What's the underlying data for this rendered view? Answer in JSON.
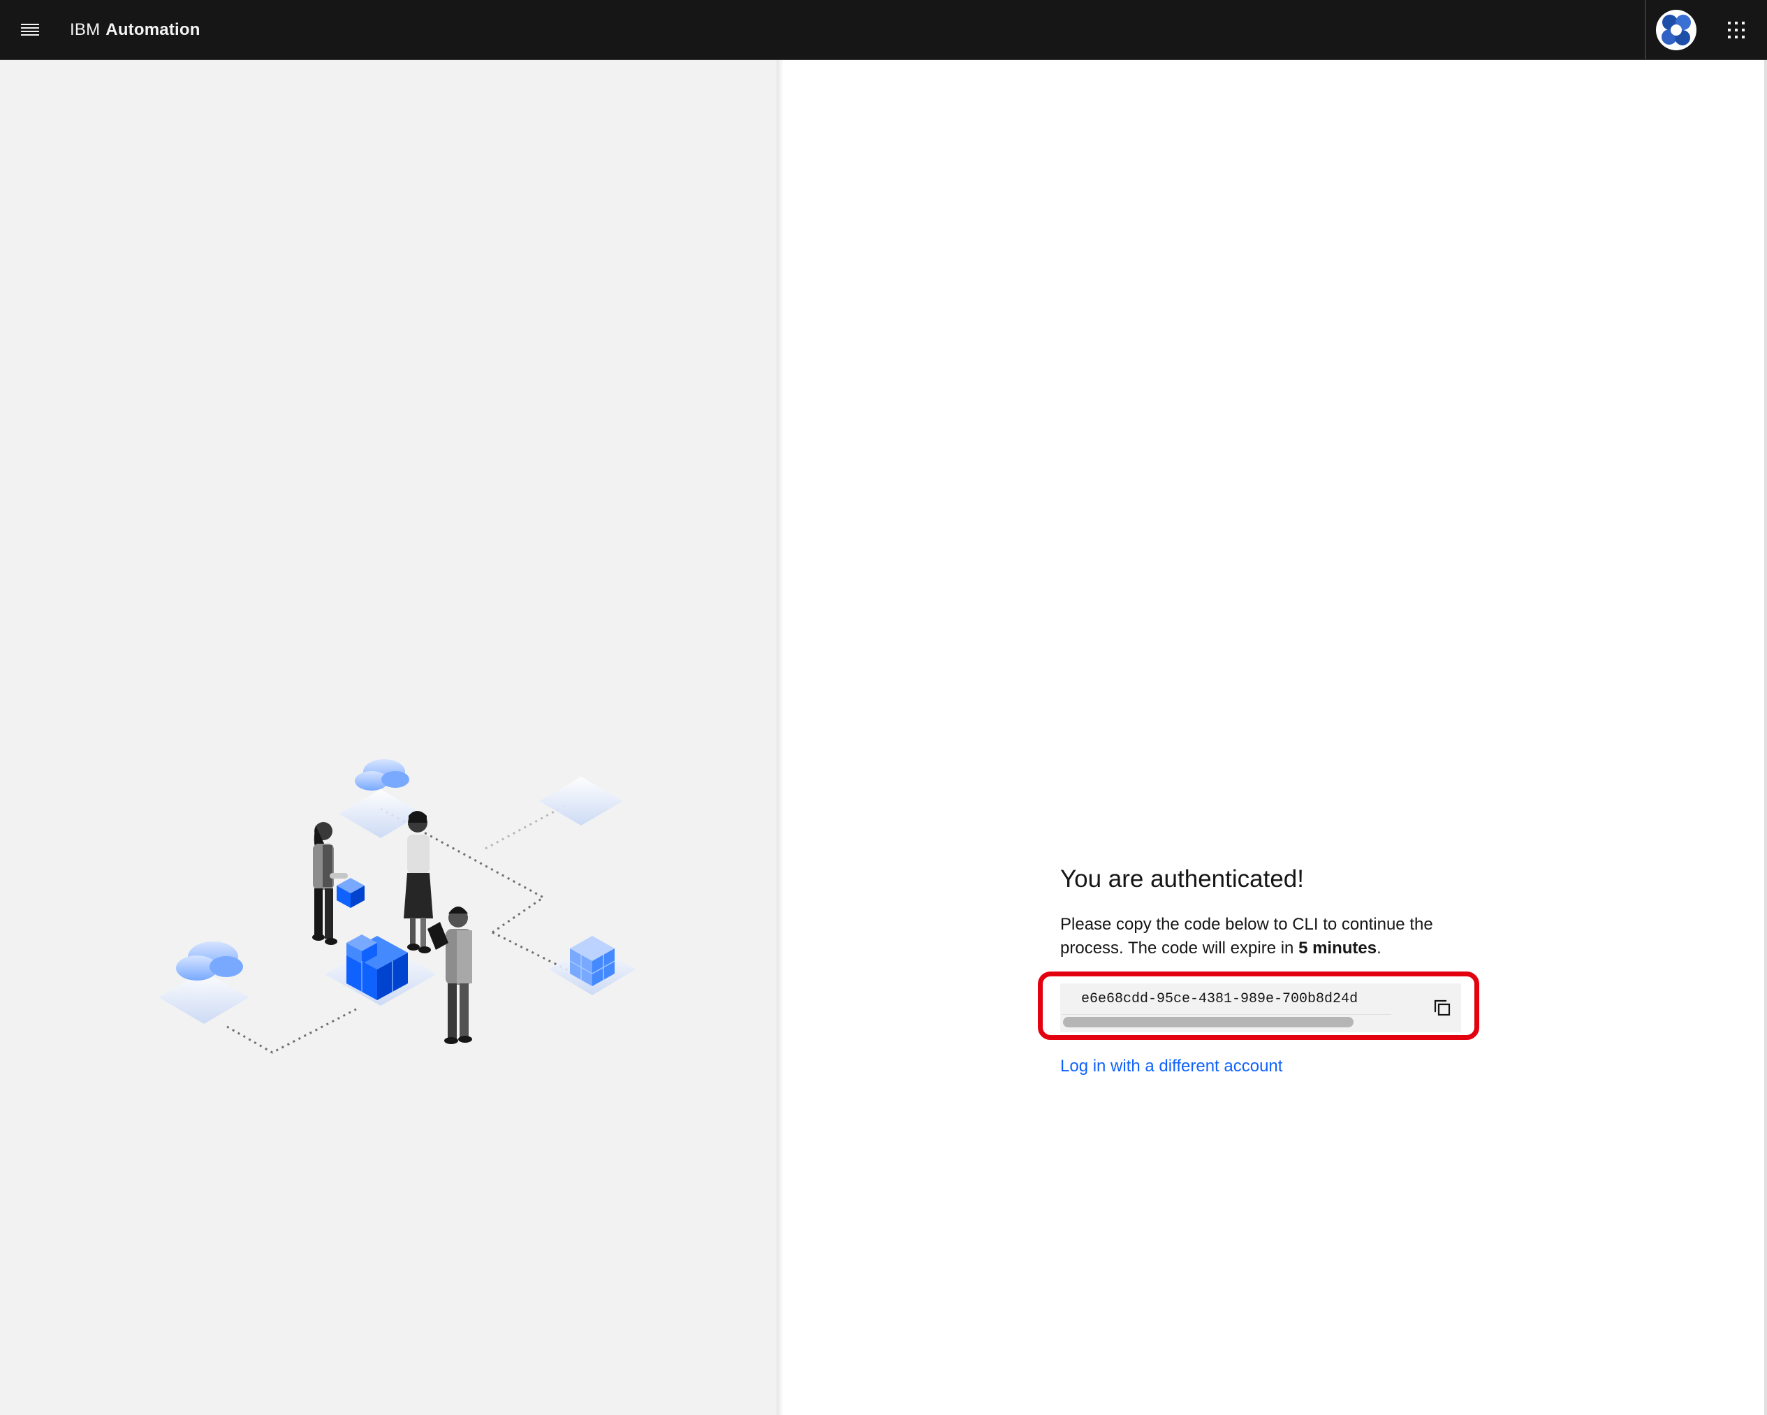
{
  "header": {
    "brand_prefix": "IBM",
    "brand_product": "Automation",
    "background": "#161616",
    "icons": {
      "menu": "hamburger-menu-icon",
      "avatar": "user-avatar-icon",
      "switcher": "app-switcher-grid-icon"
    }
  },
  "auth": {
    "title": "You are authenticated!",
    "description_start": "Please copy the code below to CLI to continue the process. The code will expire in ",
    "description_bold": "5 minutes",
    "description_end": ".",
    "code": "e6e68cdd-95ce-4381-989e-700b8d24d",
    "copy_icon": "copy-icon",
    "alternate_link": "Log in with a different account",
    "link_color": "#0f62fe",
    "highlight_color": "#e3000f"
  },
  "illustration": {
    "name": "team-collaboration-isometric-illustration",
    "accent": "#0f62fe"
  }
}
